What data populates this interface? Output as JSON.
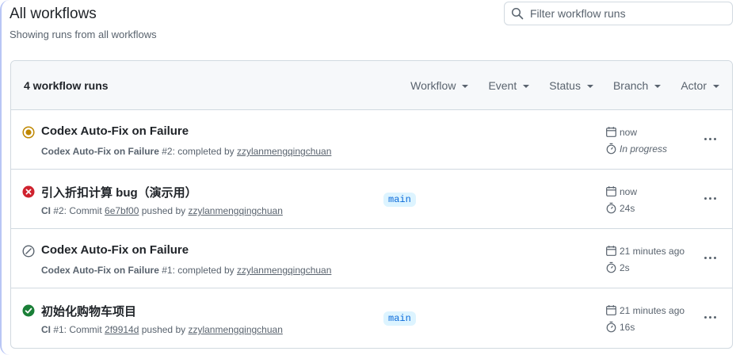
{
  "header": {
    "title": "All workflows",
    "subtitle": "Showing runs from all workflows"
  },
  "search": {
    "placeholder": "Filter workflow runs"
  },
  "list_header": {
    "count": "4 workflow runs",
    "filters": [
      "Workflow",
      "Event",
      "Status",
      "Branch",
      "Actor"
    ]
  },
  "runs": [
    {
      "status": "in-progress",
      "title": "Codex Auto-Fix on Failure",
      "workflow": "Codex Auto-Fix on Failure",
      "detail": " #2: completed by ",
      "commit": "",
      "actor": "zzylanmengqingchuan",
      "branch": "",
      "when": "now",
      "duration": "In progress"
    },
    {
      "status": "failure",
      "title": "引入折扣计算 bug（演示用）",
      "workflow": "CI",
      "detail": " #2: Commit ",
      "commit": "6e7bf00",
      "detail2": " pushed by ",
      "actor": "zzylanmengqingchuan",
      "branch": "main",
      "when": "now",
      "duration": "24s"
    },
    {
      "status": "skipped",
      "title": "Codex Auto-Fix on Failure",
      "workflow": "Codex Auto-Fix on Failure",
      "detail": " #1: completed by ",
      "commit": "",
      "actor": "zzylanmengqingchuan",
      "branch": "",
      "when": "21 minutes ago",
      "duration": "2s"
    },
    {
      "status": "success",
      "title": "初始化购物车项目",
      "workflow": "CI",
      "detail": " #1: Commit ",
      "commit": "2f9914d",
      "detail2": " pushed by ",
      "actor": "zzylanmengqingchuan",
      "branch": "main",
      "when": "21 minutes ago",
      "duration": "16s"
    }
  ],
  "colors": {
    "in_progress": "#bf8700",
    "failure": "#cf222e",
    "skipped": "#59636e",
    "success": "#1a7f37",
    "branch_bg": "#ddf4ff",
    "branch_fg": "#0969da"
  }
}
